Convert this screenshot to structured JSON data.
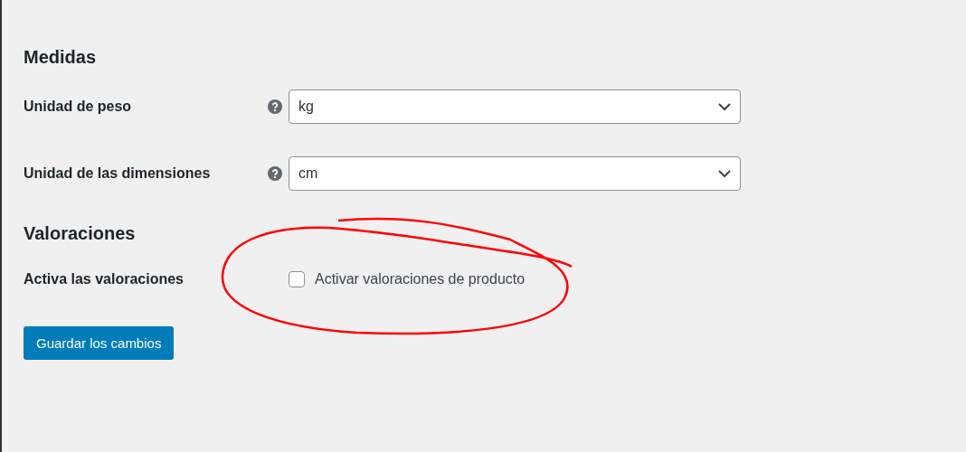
{
  "sections": [
    {
      "heading": "Medidas",
      "fields": [
        {
          "kind": "select",
          "label": "Unidad de peso",
          "value": "kg"
        },
        {
          "kind": "select",
          "label": "Unidad de las dimensiones",
          "value": "cm"
        }
      ]
    },
    {
      "heading": "Valoraciones",
      "fields": [
        {
          "kind": "checkbox",
          "label": "Activa las valoraciones",
          "option": "Activar valoraciones de producto",
          "checked": false,
          "annotated": true
        }
      ]
    }
  ],
  "save_button": "Guardar los cambios"
}
